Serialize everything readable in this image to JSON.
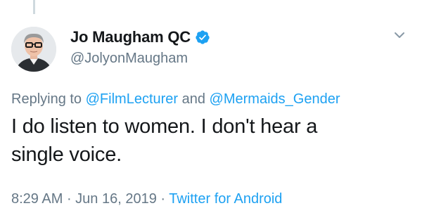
{
  "tweet": {
    "author": {
      "display_name": "Jo Maugham QC",
      "handle": "@JolyonMaugham",
      "verified": true
    },
    "reply": {
      "prefix": "Replying to ",
      "mention_1": "@FilmLecturer",
      "conjunction": " and ",
      "mention_2": "@Mermaids_Gender"
    },
    "text_line_1": "I do listen to women. I don't hear a",
    "text_line_2": "single voice.",
    "time": "8:29 AM",
    "separator_1": " · ",
    "date": "Jun 16, 2019",
    "separator_2": " · ",
    "source": "Twitter for Android"
  },
  "icons": {
    "verified": "verified-badge-icon",
    "menu": "chevron-down-icon"
  },
  "colors": {
    "accent": "#1da1f2",
    "text": "#14171a",
    "muted": "#657786"
  }
}
